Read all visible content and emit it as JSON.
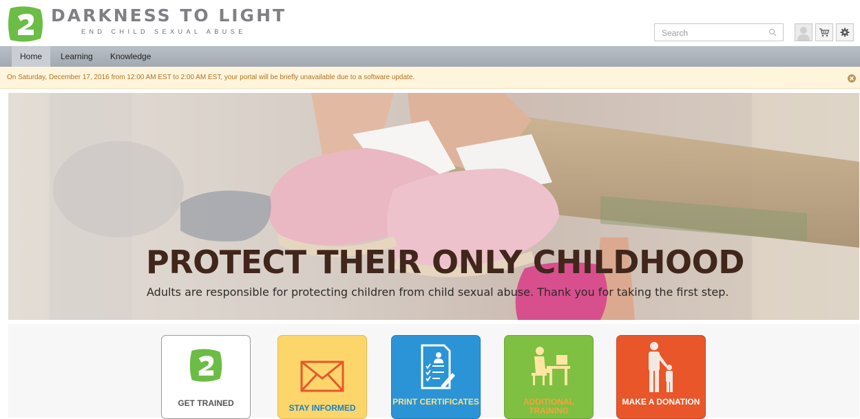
{
  "brand": {
    "title": "DARKNESS TO LIGHT",
    "tagline": "END CHILD SEXUAL ABUSE",
    "logo_color": "#6bbd45",
    "logo_icon": "d2l-logo-icon"
  },
  "search": {
    "placeholder": "Search",
    "value": ""
  },
  "header_actions": {
    "avatar_icon": "user-avatar-icon",
    "cart_icon": "cart-icon",
    "settings_icon": "gear-icon"
  },
  "nav": {
    "items": [
      {
        "label": "Home",
        "active": true
      },
      {
        "label": "Learning",
        "active": false
      },
      {
        "label": "Knowledge",
        "active": false
      }
    ]
  },
  "alert": {
    "message": "On Saturday, December 17, 2016 from 12:00 AM EST to 2:00 AM EST, your portal will be briefly unavailable due to a software update.",
    "close_icon": "close-circle-icon",
    "color": "#b46f1f"
  },
  "hero": {
    "heading": "PROTECT THEIR ONLY CHILDHOOD",
    "subheading": "Adults are responsible for protecting children from child sexual abuse. Thank you for taking the first step."
  },
  "tiles": [
    {
      "label": "GET TRAINED",
      "icon": "d2l-logo-icon",
      "bg": "#ffffff",
      "text_color": "#555555"
    },
    {
      "label": "STAY INFORMED",
      "icon": "envelope-icon",
      "bg": "#fcd66b",
      "text_color": "#1a7fc1"
    },
    {
      "label": "PRINT CERTIFICATES",
      "icon": "certificate-icon",
      "bg": "#2a94d6",
      "text_color": "#fce08a"
    },
    {
      "label": "ADDITIONAL TRAINING",
      "icon": "person-at-desk-icon",
      "bg": "#7fc042",
      "text_color": "#f4a23c"
    },
    {
      "label": "MAKE A DONATION",
      "icon": "parent-child-icon",
      "bg": "#e8562a",
      "text_color": "#ffffff"
    }
  ]
}
